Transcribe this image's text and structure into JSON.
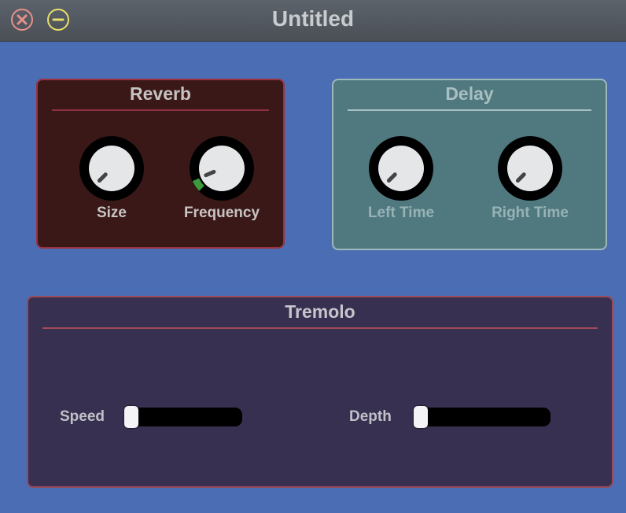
{
  "window": {
    "title": "Untitled"
  },
  "reverb": {
    "title": "Reverb",
    "knobs": [
      {
        "label": "Size",
        "value": 0.0
      },
      {
        "label": "Frequency",
        "value": 0.08
      }
    ]
  },
  "delay": {
    "title": "Delay",
    "knobs": [
      {
        "label": "Left Time",
        "value": 0.0
      },
      {
        "label": "Right Time",
        "value": 0.0
      }
    ]
  },
  "tremolo": {
    "title": "Tremolo",
    "sliders": [
      {
        "label": "Speed",
        "value": 0.0
      },
      {
        "label": "Depth",
        "value": 0.0
      }
    ]
  },
  "colors": {
    "background": "#4a6db3",
    "reverb_bg": "#3a1818",
    "delay_bg": "#50797f",
    "tremolo_bg": "#373050",
    "knob_arc_active": "#3c9a3c"
  }
}
